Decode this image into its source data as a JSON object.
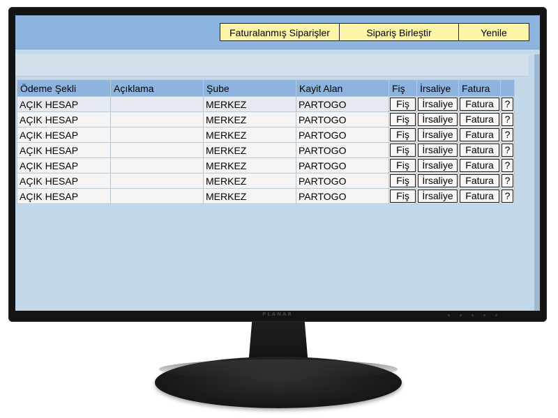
{
  "toolbar": {
    "buttons": [
      {
        "label": "Faturalanmış Siparişler"
      },
      {
        "label": "Sipariş Birleştir"
      },
      {
        "label": "Yenile"
      }
    ]
  },
  "table": {
    "columns": [
      "Ödeme Şekli",
      "Açıklama",
      "Şube",
      "Kayit Alan",
      "Fiş",
      "İrsaliye",
      "Fatura",
      ""
    ],
    "rows": [
      {
        "odeme": "AÇIK HESAP",
        "aciklama": "",
        "sube": "MERKEZ",
        "kayit": "PARTOGO",
        "fis": "Fiş",
        "irsaliye": "İrsaliye",
        "fatura": "Fatura",
        "help": "?"
      },
      {
        "odeme": "AÇIK HESAP",
        "aciklama": "",
        "sube": "MERKEZ",
        "kayit": "PARTOGO",
        "fis": "Fiş",
        "irsaliye": "İrsaliye",
        "fatura": "Fatura",
        "help": "?"
      },
      {
        "odeme": "AÇIK HESAP",
        "aciklama": "",
        "sube": "MERKEZ",
        "kayit": "PARTOGO",
        "fis": "Fiş",
        "irsaliye": "İrsaliye",
        "fatura": "Fatura",
        "help": "?"
      },
      {
        "odeme": "AÇIK HESAP",
        "aciklama": "",
        "sube": "MERKEZ",
        "kayit": "PARTOGO",
        "fis": "Fiş",
        "irsaliye": "İrsaliye",
        "fatura": "Fatura",
        "help": "?"
      },
      {
        "odeme": "AÇIK HESAP",
        "aciklama": "",
        "sube": "MERKEZ",
        "kayit": "PARTOGO",
        "fis": "Fiş",
        "irsaliye": "İrsaliye",
        "fatura": "Fatura",
        "help": "?"
      },
      {
        "odeme": "AÇIK HESAP",
        "aciklama": "",
        "sube": "MERKEZ",
        "kayit": "PARTOGO",
        "fis": "Fiş",
        "irsaliye": "İrsaliye",
        "fatura": "Fatura",
        "help": "?"
      },
      {
        "odeme": "AÇIK HESAP",
        "aciklama": "",
        "sube": "MERKEZ",
        "kayit": "PARTOGO",
        "fis": "Fiş",
        "irsaliye": "İrsaliye",
        "fatura": "Fatura",
        "help": "?"
      }
    ]
  },
  "monitor": {
    "brand": "PLANAR"
  },
  "colors": {
    "toolbar_bg": "#8db4df",
    "button_bg": "#fff5a8",
    "panel_bg": "#c3d9ea",
    "header_bg": "#8db4df"
  }
}
